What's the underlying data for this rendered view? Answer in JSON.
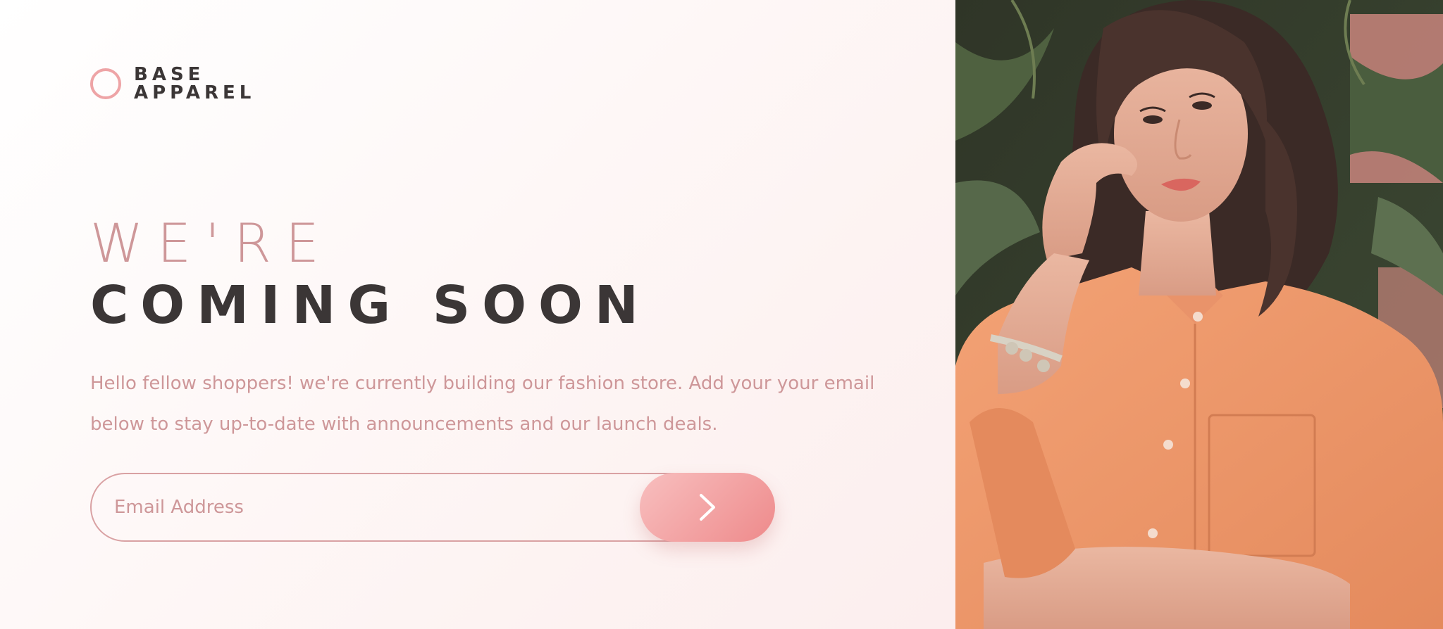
{
  "brand": {
    "line1": "BASE",
    "line2": "APPAREL",
    "accent_color": "#eea4a6",
    "text_color": "#3b3636"
  },
  "headline": {
    "light": "WE'RE",
    "dark": "COMING SOON"
  },
  "description": "Hello fellow shoppers! we're currently building our fashion store. Add your your email below to stay up-to-date with announcements and our launch deals.",
  "form": {
    "email_placeholder": "Email Address",
    "email_value": "",
    "submit_icon": "chevron-right-icon"
  },
  "hero": {
    "icon": "hero-photo-woman-orange-shirt"
  },
  "colors": {
    "soft_red": "#ce9799",
    "dark_grayish_red": "#3b3636",
    "gradient_start": "#f8bfbf",
    "gradient_end": "#ee8a8b"
  }
}
